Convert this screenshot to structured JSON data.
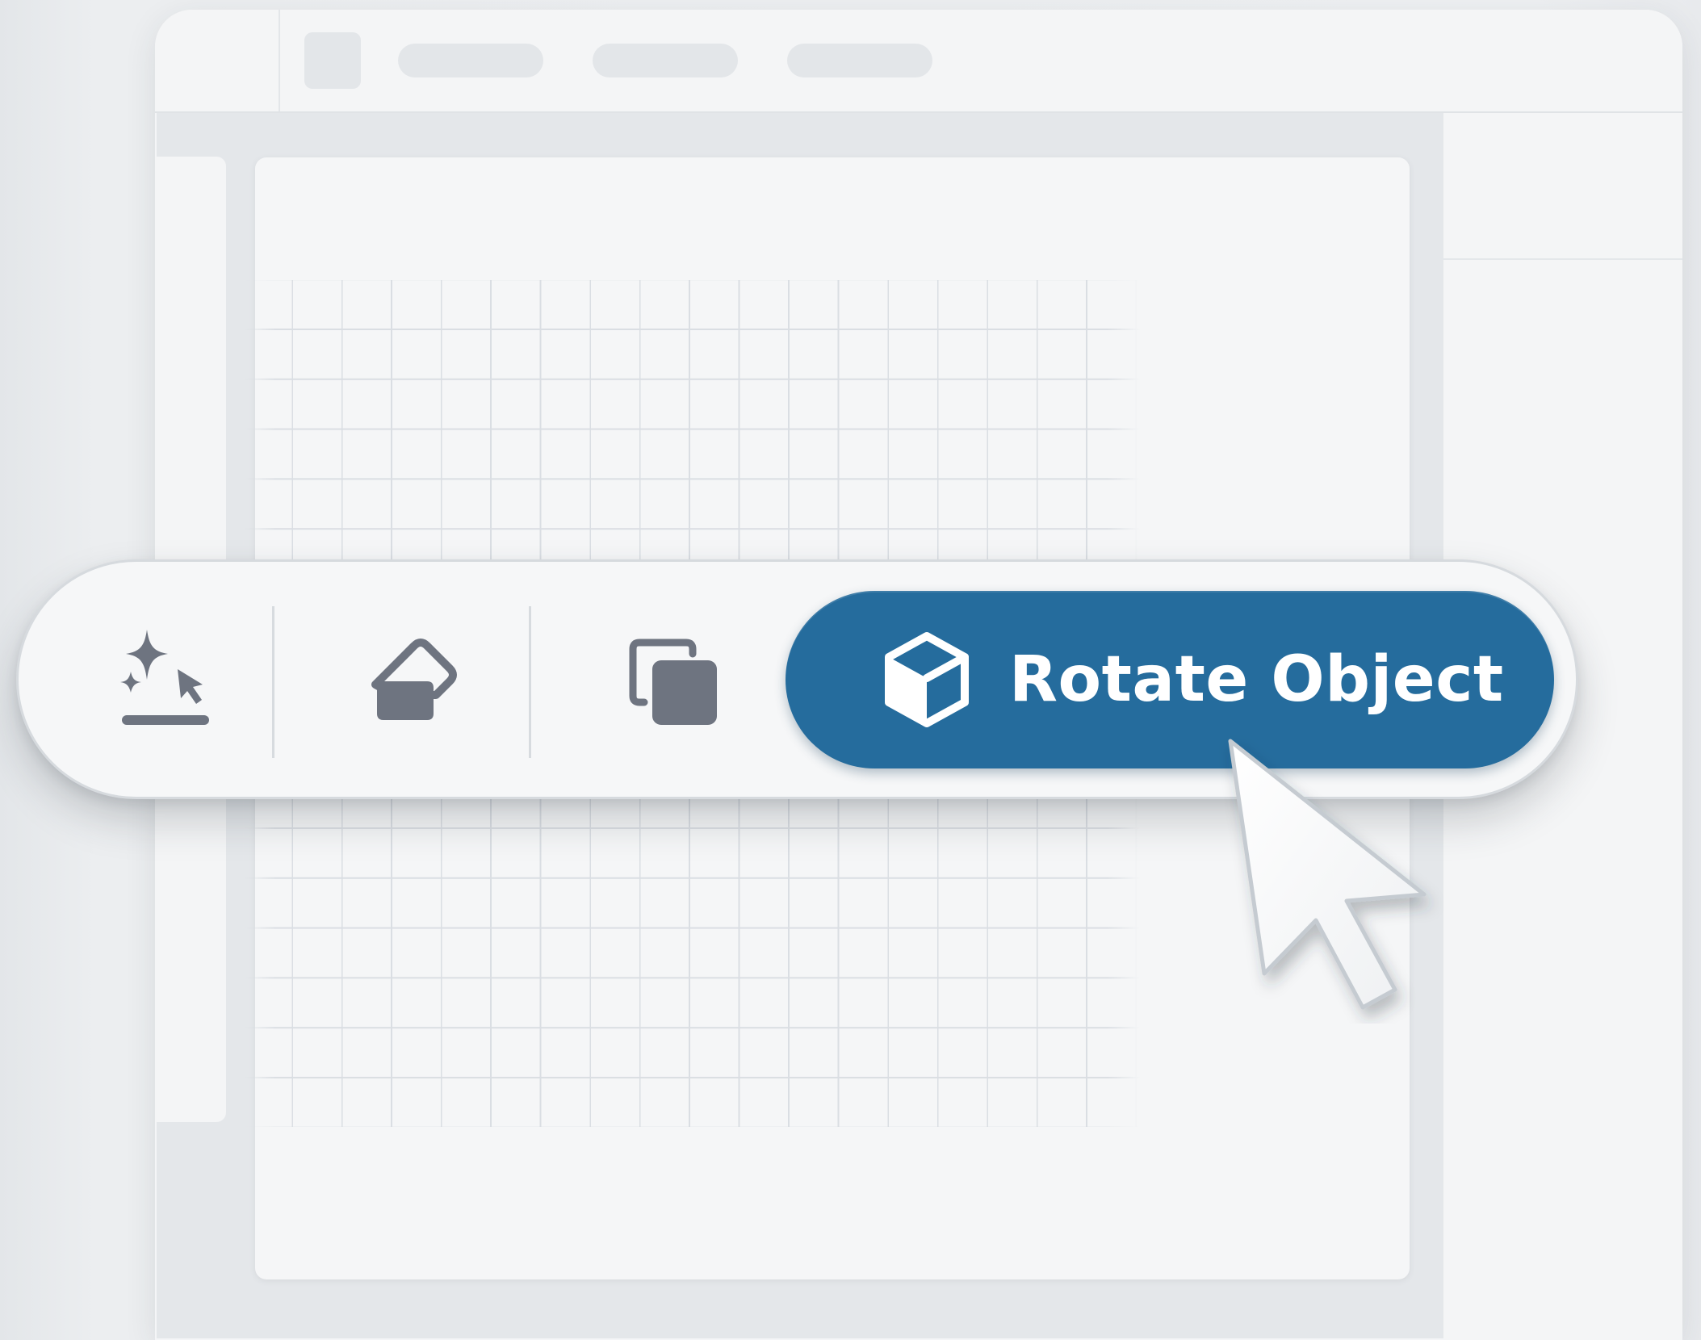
{
  "toolbar": {
    "tools": [
      {
        "name": "ai-select",
        "icon": "sparkle-cursor-icon",
        "selected": false
      },
      {
        "name": "eraser",
        "icon": "eraser-icon",
        "selected": false
      },
      {
        "name": "duplicate",
        "icon": "duplicate-icon",
        "selected": false
      }
    ],
    "primary_action": {
      "label": "Rotate Object",
      "icon": "cube-icon",
      "active": true
    }
  },
  "colors": {
    "primary_button": "#256c9d",
    "primary_text": "#ffffff",
    "tool_icon": "#6e7480",
    "background": "#eceef0",
    "canvas": "#f5f6f7",
    "grid_line": "#d9dde2"
  },
  "cursor": {
    "icon": "arrow-pointer-icon",
    "hovering": "rotate-object-button"
  }
}
